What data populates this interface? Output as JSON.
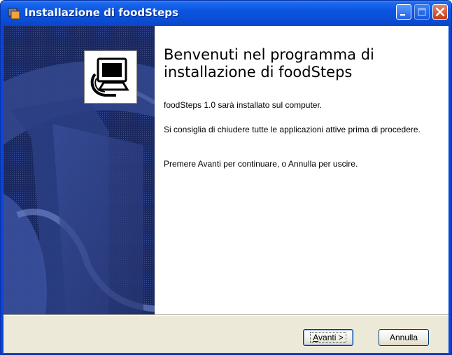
{
  "window": {
    "title": "Installazione di foodSteps",
    "controls": [
      "minimize",
      "maximize",
      "close"
    ]
  },
  "welcome": {
    "heading": "Benvenuti nel programma di installazione di foodSteps",
    "paragraphs": [
      "foodSteps 1.0 sarà installato sul computer.",
      "Si consiglia di chiudere tutte le applicazioni attive prima di procedere.",
      "Premere Avanti per continuare, o Annulla per uscire."
    ]
  },
  "buttons": {
    "next_accel": "A",
    "next_rest": "vanti >",
    "cancel": "Annulla"
  },
  "icons": {
    "app": "installer-app-icon",
    "logo": "computer-install-icon"
  },
  "colors": {
    "titlebar": "#0a4fd8",
    "sidepanel": "#1e2e6a",
    "face": "#ece9d8"
  }
}
